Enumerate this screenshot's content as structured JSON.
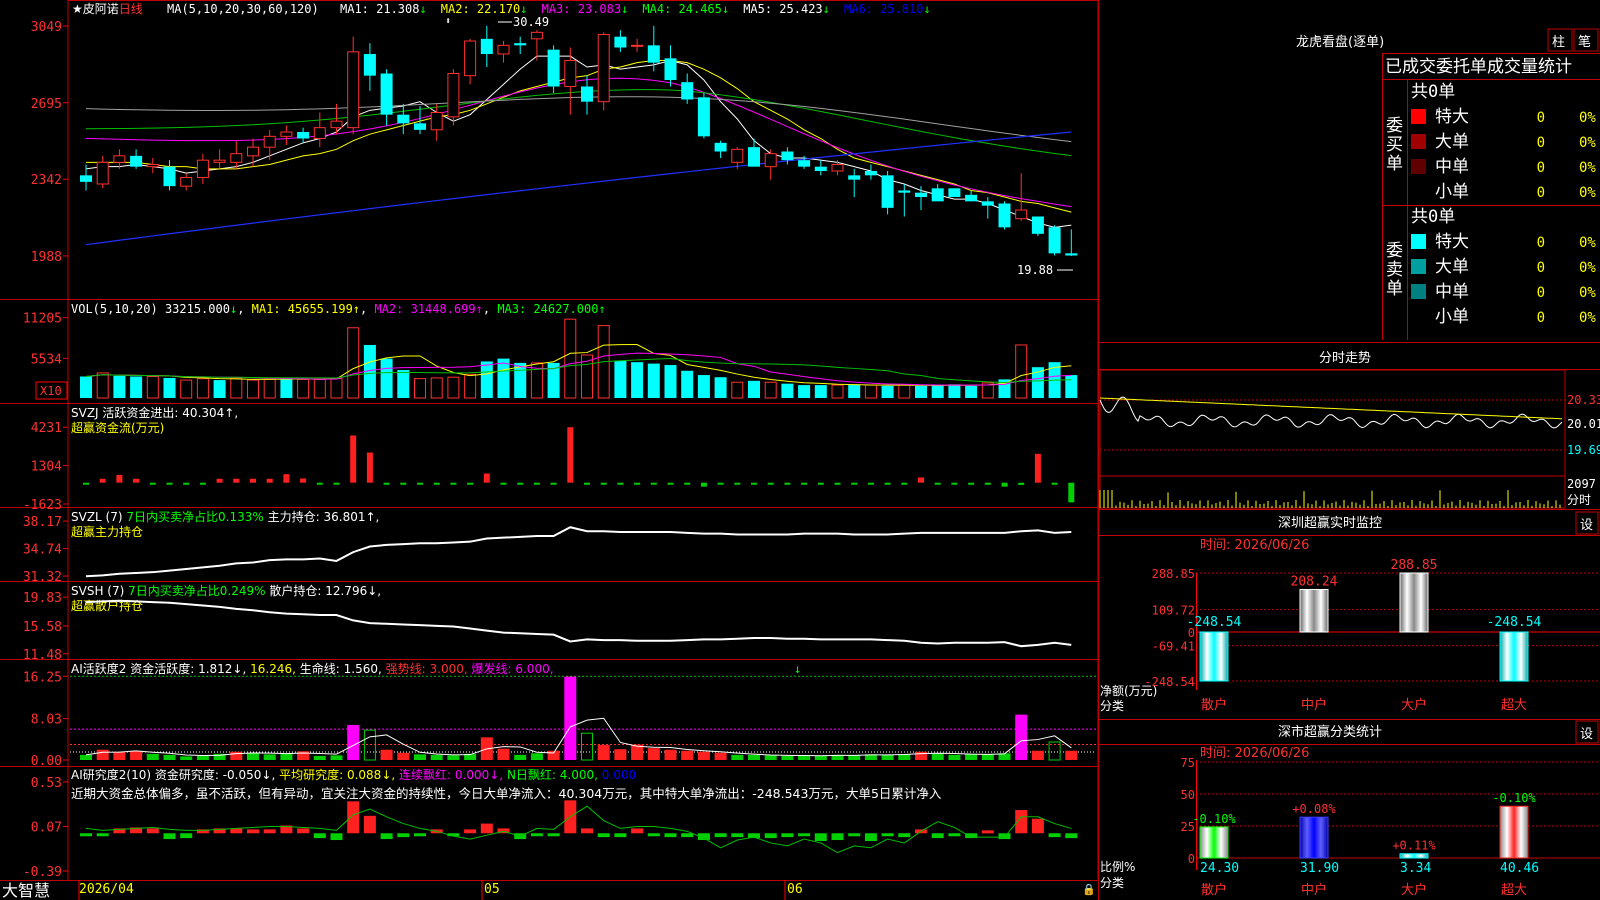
{
  "stock": {
    "star": "★",
    "name": "皮阿诺",
    "period": "日线"
  },
  "bottom": {
    "brand": "大智慧",
    "date_start": "2026/04",
    "month_may": "05",
    "month_jun": "06"
  },
  "price_panel": {
    "ma_params": "MA(5,10,20,30,60,120)",
    "ma": [
      {
        "label": "MA1:",
        "value": "21.308",
        "arrow": "↓",
        "color": "#ffffff"
      },
      {
        "label": "MA2:",
        "value": "22.170",
        "arrow": "↓",
        "color": "#ffff00"
      },
      {
        "label": "MA3:",
        "value": "23.083",
        "arrow": "↓",
        "color": "#ff00ff"
      },
      {
        "label": "MA4:",
        "value": "24.465",
        "arrow": "↓",
        "color": "#00ff00"
      },
      {
        "label": "MA5:",
        "value": "25.423",
        "arrow": "↓",
        "color": "#ffffff"
      },
      {
        "label": "MA6:",
        "value": "25.810",
        "arrow": "↓",
        "color": "#0000ff"
      }
    ],
    "y_ticks": [
      "3049",
      "2695",
      "2342",
      "1988"
    ],
    "high_label": "30.49",
    "low_label": "19.88"
  },
  "vol_panel": {
    "title": "VOL(5,10,20)",
    "value": "33215.000",
    "value_arrow": "↓",
    "ma1": "MA1: 45655.199↑",
    "ma2": "MA2: 31448.699↑",
    "ma3": "MA3: 24627.000↑",
    "y_ticks": [
      "11205",
      "5534"
    ],
    "unit": "X10"
  },
  "svzj_panel": {
    "title": "SVZJ",
    "label": "活跃资金进出:",
    "value": "40.304↑,",
    "subtitle": "超赢资金流(万元)",
    "y_ticks": [
      "4231",
      "1304",
      "-1623"
    ]
  },
  "svzl_panel": {
    "title": "SVZL (7)",
    "ratio": "7日内买卖净占比0.133%",
    "label": "主力持仓:",
    "value": "36.801↑,",
    "subtitle": "超赢主力持仓",
    "y_ticks": [
      "38.17",
      "34.74",
      "31.32"
    ]
  },
  "svsh_panel": {
    "title": "SVSH (7)",
    "ratio": "7日内买卖净占比0.249%",
    "label": "散户持仓:",
    "value": "12.796↓,",
    "subtitle": "超赢散户持仓",
    "y_ticks": [
      "19.83",
      "15.58",
      "11.48"
    ]
  },
  "ai_active_panel": {
    "title": "AI活跃度2",
    "text1": "资金活跃度: 1.812↓,",
    "text2": "16.246,",
    "text3": "生命线: 1.560,",
    "text4": "强势线: 3.000,",
    "text5": "爆发线: 6.000,",
    "y_ticks": [
      "16.25",
      "8.03",
      "0.00"
    ]
  },
  "ai_research_panel": {
    "title": "AI研究度2(10)",
    "t1": "资金研究度: -0.050↓,",
    "t2": "平均研究度: 0.088↓,",
    "t3": "连续飘红: 0.000↓,",
    "t4": "N日飘红: 4.000,",
    "t5": "0.000",
    "comment": "近期大资金总体偏多，虽不活跃，但有异动，宜关注大资金的持续性，今日大单净流入：40.304万元，其中特大单净流出：-248.543万元，大单5日累计净入",
    "y_ticks": [
      "0.53",
      "0.07",
      "-0.39"
    ]
  },
  "side": {
    "longhu_title": "龙虎看盘(逐单)",
    "btn_column": "柱",
    "btn_pen": "笔",
    "stats_title": "已成交委托单成交量统计",
    "buy": {
      "group": "委买单",
      "total": "共0单",
      "rows": [
        {
          "label": "特大",
          "count": "0",
          "pct": "0%",
          "color": "#ff0000"
        },
        {
          "label": "大单",
          "count": "0",
          "pct": "0%",
          "color": "#a00000"
        },
        {
          "label": "中单",
          "count": "0",
          "pct": "0%",
          "color": "#600000"
        },
        {
          "label": "小单",
          "count": "0",
          "pct": "0%",
          "color": "#000000"
        }
      ]
    },
    "sell": {
      "group": "委卖单",
      "total": "共0单",
      "rows": [
        {
          "label": "特大",
          "count": "0",
          "pct": "0%",
          "color": "#00ffff"
        },
        {
          "label": "大单",
          "count": "0",
          "pct": "0%",
          "color": "#00a0a0"
        },
        {
          "label": "中单",
          "count": "0",
          "pct": "0%",
          "color": "#008080"
        },
        {
          "label": "小单",
          "count": "0",
          "pct": "0%",
          "color": "#000000"
        }
      ]
    },
    "intraday": {
      "title": "分时走势",
      "p1": "20.33",
      "p2": "20.01",
      "p3": "19.69",
      "vol": "2097",
      "vol_label": "分时"
    },
    "monitor": {
      "title": "深圳超赢实时监控",
      "btn": "设",
      "time": "时间: 2026/06/26",
      "y_ticks": [
        "288.85",
        "109.72",
        "0",
        "-69.41",
        "-248.54"
      ],
      "net_label": "净额(万元)",
      "cat_label": "分类",
      "cats": [
        "散户",
        "中户",
        "大户",
        "超大"
      ],
      "values": [
        "-248.54",
        "208.24",
        "288.85",
        "-248.54"
      ]
    },
    "classify": {
      "title": "深市超赢分类统计",
      "btn": "设",
      "time": "时间: 2026/06/26",
      "y_ticks": [
        "75",
        "50",
        "25",
        "0"
      ],
      "ratio_label": "比例%",
      "cat_label": "分类",
      "cats": [
        "散户",
        "中户",
        "大户",
        "超大"
      ],
      "values": [
        "24.30",
        "31.90",
        "3.34",
        "40.46"
      ],
      "changes": [
        "-0.10%",
        "+0.08%",
        "+0.11%",
        "-0.10%"
      ]
    }
  },
  "chart_data": {
    "type": "candlestick",
    "title": "皮阿诺 日线",
    "candles": [
      {
        "o": 23.6,
        "h": 24.1,
        "l": 22.9,
        "c": 23.3
      },
      {
        "o": 23.2,
        "h": 24.5,
        "l": 23.0,
        "c": 24.2
      },
      {
        "o": 24.2,
        "h": 24.8,
        "l": 23.9,
        "c": 24.5
      },
      {
        "o": 24.5,
        "h": 24.8,
        "l": 23.9,
        "c": 24.0
      },
      {
        "o": 24.0,
        "h": 24.4,
        "l": 23.7,
        "c": 24.1
      },
      {
        "o": 24.0,
        "h": 24.3,
        "l": 22.9,
        "c": 23.1
      },
      {
        "o": 23.1,
        "h": 23.7,
        "l": 22.9,
        "c": 23.5
      },
      {
        "o": 23.5,
        "h": 24.6,
        "l": 23.2,
        "c": 24.3
      },
      {
        "o": 24.2,
        "h": 24.8,
        "l": 23.9,
        "c": 24.3
      },
      {
        "o": 24.2,
        "h": 25.2,
        "l": 23.9,
        "c": 24.6
      },
      {
        "o": 24.5,
        "h": 25.3,
        "l": 24.0,
        "c": 24.9
      },
      {
        "o": 24.9,
        "h": 25.7,
        "l": 24.3,
        "c": 25.4
      },
      {
        "o": 25.4,
        "h": 25.9,
        "l": 25.0,
        "c": 25.6
      },
      {
        "o": 25.6,
        "h": 25.8,
        "l": 25.1,
        "c": 25.3
      },
      {
        "o": 25.3,
        "h": 26.5,
        "l": 24.9,
        "c": 25.8
      },
      {
        "o": 25.8,
        "h": 26.9,
        "l": 25.5,
        "c": 26.1
      },
      {
        "o": 25.8,
        "h": 30.0,
        "l": 25.5,
        "c": 29.3
      },
      {
        "o": 29.2,
        "h": 29.7,
        "l": 27.5,
        "c": 28.2
      },
      {
        "o": 28.3,
        "h": 28.5,
        "l": 25.9,
        "c": 26.4
      },
      {
        "o": 26.4,
        "h": 26.9,
        "l": 25.5,
        "c": 26.0
      },
      {
        "o": 26.0,
        "h": 26.8,
        "l": 25.5,
        "c": 25.7
      },
      {
        "o": 25.7,
        "h": 26.9,
        "l": 25.2,
        "c": 26.5
      },
      {
        "o": 26.3,
        "h": 28.5,
        "l": 25.9,
        "c": 28.3
      },
      {
        "o": 28.2,
        "h": 29.9,
        "l": 27.8,
        "c": 29.8
      },
      {
        "o": 29.9,
        "h": 30.5,
        "l": 28.6,
        "c": 29.2
      },
      {
        "o": 29.2,
        "h": 29.8,
        "l": 28.8,
        "c": 29.6
      },
      {
        "o": 29.7,
        "h": 30.0,
        "l": 29.2,
        "c": 29.6
      },
      {
        "o": 29.9,
        "h": 30.3,
        "l": 28.9,
        "c": 30.2
      },
      {
        "o": 29.4,
        "h": 29.6,
        "l": 27.4,
        "c": 27.7
      },
      {
        "o": 27.7,
        "h": 29.5,
        "l": 26.4,
        "c": 28.9
      },
      {
        "o": 27.7,
        "h": 28.2,
        "l": 26.4,
        "c": 27.0
      },
      {
        "o": 27.0,
        "h": 30.2,
        "l": 26.6,
        "c": 30.1
      },
      {
        "o": 30.0,
        "h": 30.3,
        "l": 29.3,
        "c": 29.5
      },
      {
        "o": 29.6,
        "h": 29.9,
        "l": 29.3,
        "c": 29.6
      },
      {
        "o": 29.6,
        "h": 30.5,
        "l": 28.4,
        "c": 28.8
      },
      {
        "o": 29.0,
        "h": 29.6,
        "l": 27.7,
        "c": 28.0
      },
      {
        "o": 27.9,
        "h": 28.3,
        "l": 26.9,
        "c": 27.1
      },
      {
        "o": 27.2,
        "h": 27.4,
        "l": 25.3,
        "c": 25.4
      },
      {
        "o": 25.1,
        "h": 25.2,
        "l": 24.4,
        "c": 24.7
      },
      {
        "o": 24.2,
        "h": 24.9,
        "l": 23.9,
        "c": 24.8
      },
      {
        "o": 24.9,
        "h": 25.3,
        "l": 24.1,
        "c": 24.0
      },
      {
        "o": 24.0,
        "h": 24.8,
        "l": 23.4,
        "c": 24.6
      },
      {
        "o": 24.7,
        "h": 24.9,
        "l": 24.1,
        "c": 24.3
      },
      {
        "o": 24.3,
        "h": 24.5,
        "l": 23.9,
        "c": 24.0
      },
      {
        "o": 24.0,
        "h": 24.3,
        "l": 23.6,
        "c": 23.8
      },
      {
        "o": 23.8,
        "h": 24.3,
        "l": 23.6,
        "c": 24.1
      },
      {
        "o": 23.6,
        "h": 23.9,
        "l": 22.6,
        "c": 23.4
      },
      {
        "o": 23.8,
        "h": 24.1,
        "l": 23.4,
        "c": 23.6
      },
      {
        "o": 23.6,
        "h": 23.8,
        "l": 21.8,
        "c": 22.1
      },
      {
        "o": 22.9,
        "h": 23.2,
        "l": 21.7,
        "c": 22.8
      },
      {
        "o": 22.8,
        "h": 23.1,
        "l": 22.0,
        "c": 22.6
      },
      {
        "o": 23.0,
        "h": 23.2,
        "l": 22.5,
        "c": 22.4
      },
      {
        "o": 23.0,
        "h": 23.0,
        "l": 22.6,
        "c": 22.6
      },
      {
        "o": 22.7,
        "h": 22.9,
        "l": 22.4,
        "c": 22.4
      },
      {
        "o": 22.4,
        "h": 22.6,
        "l": 21.6,
        "c": 22.2
      },
      {
        "o": 22.3,
        "h": 22.4,
        "l": 21.1,
        "c": 21.2
      },
      {
        "o": 21.6,
        "h": 23.7,
        "l": 21.5,
        "c": 22.0
      },
      {
        "o": 21.7,
        "h": 21.7,
        "l": 20.8,
        "c": 20.9
      },
      {
        "o": 21.2,
        "h": 21.3,
        "l": 19.9,
        "c": 20.0
      },
      {
        "o": 20.0,
        "h": 21.1,
        "l": 19.88,
        "c": 19.9
      }
    ],
    "ma5": [
      23.9,
      24.0,
      24.0,
      24.1,
      24.0,
      23.9,
      23.7,
      23.8,
      23.9,
      24.0,
      24.2,
      24.5,
      24.8,
      25.1,
      25.3,
      25.6,
      26.3,
      26.6,
      26.7,
      26.8,
      27.0,
      26.5,
      26.1,
      26.4,
      27.1,
      27.8,
      28.5,
      29.1,
      29.1,
      29.1,
      28.6,
      28.7,
      28.5,
      28.6,
      28.7,
      28.9,
      28.7,
      28.0,
      27.0,
      26.2,
      25.2,
      24.6,
      24.4,
      24.4,
      24.3,
      24.2,
      24.0,
      23.8,
      23.4,
      23.2,
      22.9,
      22.7,
      22.5,
      22.5,
      22.3,
      22.0,
      21.7,
      21.4,
      21.2,
      21.3
    ],
    "ma10": [
      24.2,
      24.2,
      24.2,
      24.2,
      24.1,
      24.0,
      24.0,
      23.9,
      23.9,
      23.9,
      24.0,
      24.1,
      24.3,
      24.5,
      24.6,
      24.8,
      25.2,
      25.5,
      25.7,
      25.9,
      26.1,
      26.3,
      26.4,
      26.6,
      26.9,
      27.2,
      27.5,
      27.7,
      27.9,
      28.1,
      28.2,
      28.5,
      28.6,
      28.8,
      28.9,
      28.9,
      28.8,
      28.5,
      28.1,
      27.6,
      27.0,
      26.6,
      26.2,
      25.7,
      25.3,
      24.8,
      24.4,
      24.2,
      24.0,
      23.8,
      23.6,
      23.4,
      23.2,
      22.9,
      22.8,
      22.6,
      22.4,
      22.3,
      22.1,
      21.9
    ],
    "vol": [
      3000,
      3500,
      3100,
      3000,
      3000,
      2800,
      2500,
      2700,
      2500,
      2800,
      2500,
      2600,
      2800,
      2600,
      2600,
      2700,
      9800,
      7400,
      5500,
      3900,
      2700,
      2800,
      2900,
      3300,
      5100,
      5500,
      4900,
      4900,
      4900,
      11000,
      6000,
      10100,
      5200,
      5000,
      4800,
      4600,
      3800,
      3200,
      2900,
      2200,
      2400,
      2200,
      2000,
      1800,
      1800,
      1800,
      1900,
      1800,
      1700,
      1800,
      1700,
      1800,
      1900,
      1700,
      2100,
      2600,
      7400,
      4300,
      5000,
      3200
    ],
    "vol_up": [
      false,
      true,
      false,
      false,
      true,
      false,
      true,
      true,
      false,
      true,
      true,
      true,
      false,
      true,
      true,
      true,
      true,
      false,
      false,
      false,
      true,
      true,
      true,
      true,
      false,
      false,
      false,
      true,
      false,
      true,
      true,
      true,
      false,
      false,
      false,
      false,
      false,
      false,
      false,
      true,
      false,
      true,
      false,
      false,
      false,
      true,
      false,
      true,
      false,
      true,
      false,
      false,
      false,
      false,
      true,
      false,
      true,
      false,
      false,
      false
    ],
    "svzj": [
      -80,
      300,
      600,
      300,
      -70,
      -70,
      -80,
      -50,
      300,
      300,
      300,
      300,
      650,
      320,
      -40,
      -50,
      3600,
      2300,
      -60,
      -40,
      -50,
      -60,
      -50,
      -40,
      700,
      -60,
      -120,
      -40,
      -50,
      4231,
      -50,
      -120,
      -40,
      -50,
      -40,
      -60,
      -100,
      -300,
      -60,
      -40,
      -40,
      -60,
      -50,
      -40,
      -40,
      -40,
      -60,
      -40,
      -50,
      -40,
      400,
      -40,
      -50,
      -40,
      -60,
      -300,
      -170,
      2200,
      -40,
      -1500
    ],
    "svzl": [
      31.3,
      31.4,
      31.6,
      31.7,
      31.8,
      32.0,
      32.2,
      32.4,
      32.6,
      32.9,
      33.0,
      33.3,
      33.4,
      33.4,
      33.5,
      33.2,
      34.3,
      35.0,
      35.2,
      35.3,
      35.4,
      35.4,
      35.5,
      35.6,
      36.0,
      36.1,
      36.2,
      36.3,
      36.3,
      37.4,
      36.9,
      36.9,
      36.8,
      36.8,
      36.8,
      36.8,
      36.7,
      36.6,
      36.6,
      36.5,
      36.5,
      36.5,
      36.5,
      36.6,
      36.6,
      36.6,
      36.5,
      36.5,
      36.5,
      36.6,
      36.7,
      36.7,
      36.7,
      36.7,
      36.7,
      36.7,
      36.9,
      37.0,
      36.7,
      36.8
    ],
    "svsh": [
      19.1,
      19.2,
      19.3,
      19.2,
      19.1,
      19.0,
      18.8,
      18.6,
      18.4,
      18.1,
      17.9,
      17.6,
      17.4,
      17.3,
      17.2,
      17.2,
      16.4,
      16.0,
      15.9,
      15.8,
      15.7,
      15.6,
      15.5,
      15.2,
      14.9,
      14.6,
      14.5,
      14.4,
      14.3,
      13.3,
      13.6,
      13.5,
      13.5,
      13.4,
      13.4,
      13.4,
      13.5,
      13.6,
      13.6,
      13.7,
      13.8,
      13.8,
      13.7,
      13.7,
      13.6,
      13.6,
      13.6,
      13.6,
      13.5,
      13.4,
      13.1,
      13.0,
      13.1,
      13.1,
      13.1,
      13.2,
      12.6,
      12.8,
      13.1,
      12.8
    ],
    "ai_active": [
      1.0,
      2.0,
      1.6,
      1.7,
      1.2,
      1.0,
      0.7,
      0.9,
      1.2,
      1.6,
      1.3,
      1.1,
      1.3,
      1.7,
      0.8,
      0.9,
      6.8,
      5.8,
      2.0,
      1.4,
      1.1,
      1.0,
      0.9,
      1.2,
      4.4,
      2.2,
      1.0,
      1.3,
      1.8,
      16.2,
      5.2,
      2.9,
      2.1,
      3.0,
      2.3,
      2.0,
      1.8,
      1.6,
      1.4,
      1.0,
      1.0,
      0.9,
      0.8,
      0.9,
      0.8,
      1.0,
      0.9,
      1.1,
      1.0,
      1.1,
      1.6,
      1.2,
      1.0,
      1.2,
      1.1,
      1.3,
      8.8,
      1.8,
      3.5,
      1.8
    ],
    "ai_research": [
      -0.02,
      -0.03,
      0.05,
      0.06,
      0.05,
      -0.06,
      -0.05,
      0.04,
      0.05,
      0.05,
      0.04,
      0.04,
      0.08,
      0.05,
      -0.05,
      -0.07,
      0.33,
      0.18,
      -0.06,
      -0.04,
      -0.03,
      0.04,
      -0.03,
      0.04,
      0.1,
      0.05,
      -0.06,
      -0.03,
      -0.03,
      0.34,
      0.05,
      -0.04,
      -0.04,
      0.05,
      -0.03,
      -0.04,
      -0.04,
      -0.07,
      -0.04,
      -0.04,
      -0.05,
      -0.05,
      -0.04,
      -0.03,
      -0.08,
      -0.07,
      -0.03,
      -0.08,
      -0.03,
      -0.04,
      0.04,
      -0.05,
      -0.03,
      -0.05,
      0.03,
      -0.06,
      0.24,
      0.15,
      -0.04,
      -0.05
    ],
    "ai_research_line": [
      0.05,
      0.03,
      0.04,
      0.05,
      0.06,
      0.04,
      0.03,
      0.03,
      0.04,
      0.05,
      0.06,
      0.07,
      0.07,
      0.06,
      0.05,
      0.03,
      0.19,
      0.25,
      0.17,
      0.1,
      0.05,
      0.02,
      -0.03,
      -0.06,
      -0.02,
      0.02,
      -0.03,
      0.05,
      0.04,
      0.17,
      0.28,
      0.13,
      0.05,
      0.07,
      0.07,
      0.05,
      0.02,
      -0.05,
      -0.15,
      -0.07,
      -0.04,
      -0.1,
      -0.13,
      -0.06,
      -0.1,
      -0.2,
      -0.13,
      -0.15,
      -0.06,
      -0.1,
      0.02,
      0.12,
      0.06,
      -0.04,
      -0.04,
      -0.04,
      0.17,
      0.17,
      0.1,
      0.05
    ]
  }
}
